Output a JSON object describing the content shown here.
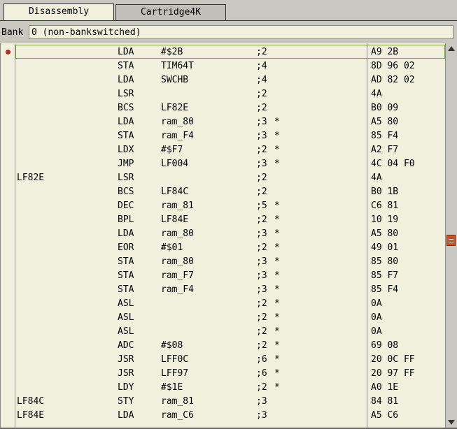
{
  "tabs": [
    {
      "label": "Disassembly",
      "active": true
    },
    {
      "label": "Cartridge4K",
      "active": false
    }
  ],
  "bank": {
    "label": "Bank",
    "value": "0 (non-bankswitched)"
  },
  "colors": {
    "background": "#f0f0dc",
    "current_line_outline": "#7aa03a",
    "breakpoint": "#b03020",
    "scroll_thumb": "#d0501a"
  },
  "rows": [
    {
      "label": "",
      "op": "LDA",
      "arg": "#$2B",
      "cycles": ";2",
      "star": "",
      "bytes": "A9 2B",
      "current": true,
      "breakpoint": true
    },
    {
      "label": "",
      "op": "STA",
      "arg": "TIM64T",
      "cycles": ";4",
      "star": "",
      "bytes": "8D 96 02"
    },
    {
      "label": "",
      "op": "LDA",
      "arg": "SWCHB",
      "cycles": ";4",
      "star": "",
      "bytes": "AD 82 02"
    },
    {
      "label": "",
      "op": "LSR",
      "arg": "",
      "cycles": ";2",
      "star": "",
      "bytes": "4A"
    },
    {
      "label": "",
      "op": "BCS",
      "arg": "LF82E",
      "cycles": ";2",
      "star": "",
      "bytes": "B0 09"
    },
    {
      "label": "",
      "op": "LDA",
      "arg": "ram_80",
      "cycles": ";3",
      "star": "*",
      "bytes": "A5 80"
    },
    {
      "label": "",
      "op": "STA",
      "arg": "ram_F4",
      "cycles": ";3",
      "star": "*",
      "bytes": "85 F4"
    },
    {
      "label": "",
      "op": "LDX",
      "arg": "#$F7",
      "cycles": ";2",
      "star": "*",
      "bytes": "A2 F7"
    },
    {
      "label": "",
      "op": "JMP",
      "arg": "LF004",
      "cycles": ";3",
      "star": "*",
      "bytes": "4C 04 F0"
    },
    {
      "label": "LF82E",
      "op": "LSR",
      "arg": "",
      "cycles": ";2",
      "star": "",
      "bytes": "4A"
    },
    {
      "label": "",
      "op": "BCS",
      "arg": "LF84C",
      "cycles": ";2",
      "star": "",
      "bytes": "B0 1B"
    },
    {
      "label": "",
      "op": "DEC",
      "arg": "ram_81",
      "cycles": ";5",
      "star": "*",
      "bytes": "C6 81"
    },
    {
      "label": "",
      "op": "BPL",
      "arg": "LF84E",
      "cycles": ";2",
      "star": "*",
      "bytes": "10 19"
    },
    {
      "label": "",
      "op": "LDA",
      "arg": "ram_80",
      "cycles": ";3",
      "star": "*",
      "bytes": "A5 80"
    },
    {
      "label": "",
      "op": "EOR",
      "arg": "#$01",
      "cycles": ";2",
      "star": "*",
      "bytes": "49 01"
    },
    {
      "label": "",
      "op": "STA",
      "arg": "ram_80",
      "cycles": ";3",
      "star": "*",
      "bytes": "85 80"
    },
    {
      "label": "",
      "op": "STA",
      "arg": "ram_F7",
      "cycles": ";3",
      "star": "*",
      "bytes": "85 F7"
    },
    {
      "label": "",
      "op": "STA",
      "arg": "ram_F4",
      "cycles": ";3",
      "star": "*",
      "bytes": "85 F4"
    },
    {
      "label": "",
      "op": "ASL",
      "arg": "",
      "cycles": ";2",
      "star": "*",
      "bytes": "0A"
    },
    {
      "label": "",
      "op": "ASL",
      "arg": "",
      "cycles": ";2",
      "star": "*",
      "bytes": "0A"
    },
    {
      "label": "",
      "op": "ASL",
      "arg": "",
      "cycles": ";2",
      "star": "*",
      "bytes": "0A"
    },
    {
      "label": "",
      "op": "ADC",
      "arg": "#$08",
      "cycles": ";2",
      "star": "*",
      "bytes": "69 08"
    },
    {
      "label": "",
      "op": "JSR",
      "arg": "LFF0C",
      "cycles": ";6",
      "star": "*",
      "bytes": "20 0C FF"
    },
    {
      "label": "",
      "op": "JSR",
      "arg": "LFF97",
      "cycles": ";6",
      "star": "*",
      "bytes": "20 97 FF"
    },
    {
      "label": "",
      "op": "LDY",
      "arg": "#$1E",
      "cycles": ";2",
      "star": "*",
      "bytes": "A0 1E"
    },
    {
      "label": "LF84C",
      "op": "STY",
      "arg": "ram_81",
      "cycles": ";3",
      "star": "",
      "bytes": "84 81"
    },
    {
      "label": "LF84E",
      "op": "LDA",
      "arg": "ram_C6",
      "cycles": ";3",
      "star": "",
      "bytes": "A5 C6"
    }
  ]
}
